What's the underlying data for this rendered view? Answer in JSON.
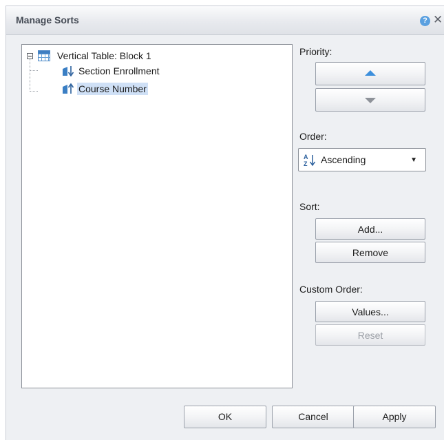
{
  "dialog": {
    "title": "Manage Sorts",
    "help_symbol": "?",
    "close_symbol": "✕"
  },
  "tree": {
    "root": {
      "label": "Vertical Table: Block 1",
      "icon": "table-icon",
      "expanded": true
    },
    "items": [
      {
        "label": "Section Enrollment",
        "icon": "sort-descending-icon",
        "selected": false
      },
      {
        "label": "Course Number",
        "icon": "sort-ascending-icon",
        "selected": true
      }
    ]
  },
  "priority": {
    "label": "Priority:",
    "up_icon": "arrow-up-icon",
    "down_icon": "arrow-down-icon"
  },
  "order": {
    "label": "Order:",
    "value": "Ascending",
    "icon": "sort-az-icon",
    "dropdown_icon": "dropdown-caret-icon",
    "caret_symbol": "▼"
  },
  "sort": {
    "label": "Sort:",
    "add_label": "Add...",
    "remove_label": "Remove"
  },
  "custom_order": {
    "label": "Custom Order:",
    "values_label": "Values...",
    "reset_label": "Reset",
    "reset_enabled": false
  },
  "footer": {
    "ok_label": "OK",
    "cancel_label": "Cancel",
    "apply_label": "Apply"
  },
  "colors": {
    "accent": "#3d8fdc",
    "selection": "#cfe0f6",
    "dialog_bg": "#eef0f3"
  }
}
